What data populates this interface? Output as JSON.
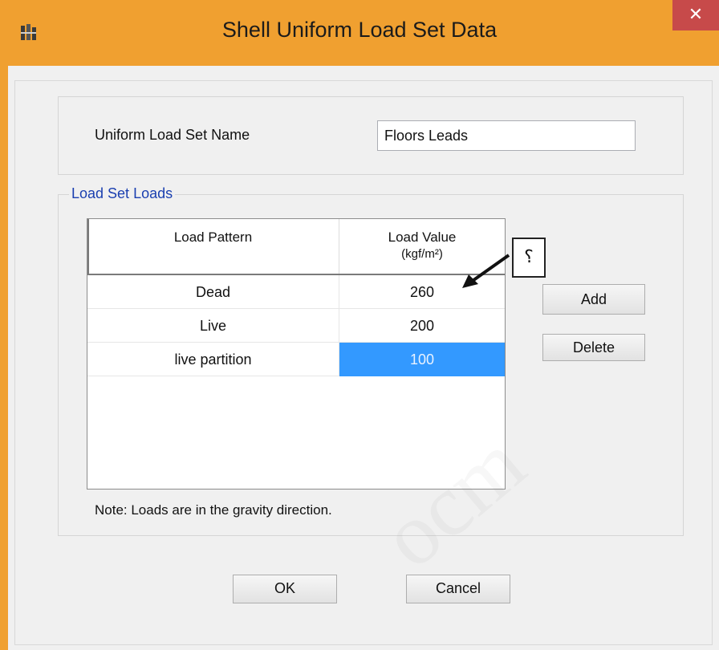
{
  "window": {
    "title": "Shell Uniform Load Set Data",
    "close_label": "✕",
    "accent_color": "#f0a030"
  },
  "form": {
    "name_label": "Uniform Load Set Name",
    "name_value": "Floors Leads"
  },
  "loads_group": {
    "legend": "Load Set Loads",
    "columns": [
      {
        "title": "Load Pattern",
        "subtitle": ""
      },
      {
        "title": "Load Value",
        "subtitle": "(kgf/m²)"
      }
    ],
    "rows": [
      {
        "pattern": "Dead",
        "value": "260"
      },
      {
        "pattern": "Live",
        "value": "200"
      },
      {
        "pattern": "live partition",
        "value": "100"
      }
    ],
    "selected_row_index": 2,
    "note": "Note:  Loads are in the gravity direction."
  },
  "buttons": {
    "add": "Add",
    "delete": "Delete",
    "ok": "OK",
    "cancel": "Cancel"
  },
  "annotation": {
    "callout_text": "؟"
  },
  "watermark_text": "ocm"
}
